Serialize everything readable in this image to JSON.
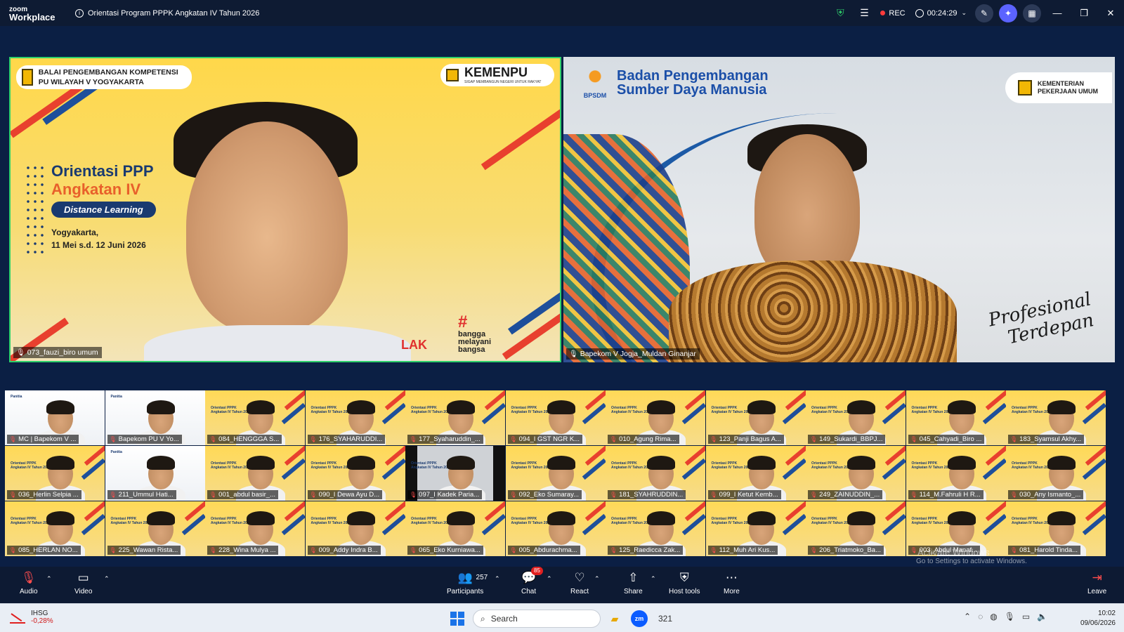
{
  "app": {
    "zoom": "zoom",
    "workplace": "Workplace"
  },
  "meeting_title": "Orientasi Program PPPK Angkatan IV Tahun 2026",
  "titlebar": {
    "rec": "REC",
    "timer": "00:24:29"
  },
  "speakers": [
    {
      "name": "073_fauzi_biro umum",
      "badge_left": "BALAI PENGEMBANGAN KOMPETENSI PU WILAYAH V YOGYAKARTA",
      "badge_right": "KEMENPU",
      "badge_right_sub": "SIGAP MEMBANGUN NEGERI UNTUK RAKYAT",
      "title_1": "Orientasi PPP",
      "title_2": "Angkatan IV",
      "pill": "Distance Learning",
      "location": "Yogyakarta,",
      "dates": "11 Mei s.d. 12 Juni 2026",
      "bangga": "#",
      "bangga_text": "bangga melayani bangsa",
      "lak": "LAK"
    },
    {
      "name": "Bapekom V Jogja_Muldan Ginanjar",
      "org_short": "BPSDM",
      "org_line1": "Badan Pengembangan",
      "org_line2": "Sumber Daya Manusia",
      "kementerian": "KEMENTERIAN PEKERJAAN UMUM",
      "motto_1": "Profesional",
      "motto_2": "Terdepan"
    }
  ],
  "participants": [
    {
      "name": "MC | Bapekom V ...",
      "style": "white"
    },
    {
      "name": "Bapekom PU V Yo...",
      "style": "white"
    },
    {
      "name": "084_HENGGGA S...",
      "style": "yellow"
    },
    {
      "name": "176_SYAHARUDDI...",
      "style": "yellow"
    },
    {
      "name": "177_Syaharuddin_...",
      "style": "yellow"
    },
    {
      "name": "094_I GST NGR K...",
      "style": "yellow"
    },
    {
      "name": "010_Agung Rima...",
      "style": "yellow"
    },
    {
      "name": "123_Panji Bagus A...",
      "style": "yellow"
    },
    {
      "name": "149_Sukardi_BBPJ...",
      "style": "yellow"
    },
    {
      "name": "045_Cahyadi_Biro ...",
      "style": "yellow"
    },
    {
      "name": "183_Syamsul Akhy...",
      "style": "yellow"
    },
    {
      "name": "036_Herlin Selpia ...",
      "style": "yellow"
    },
    {
      "name": "211_Ummul Hati...",
      "style": "white"
    },
    {
      "name": "001_abdul basir_...",
      "style": "yellow"
    },
    {
      "name": "090_I Dewa Ayu D...",
      "style": "yellow"
    },
    {
      "name": "097_I Kadek Paria...",
      "style": "dark"
    },
    {
      "name": "092_Eko Sumaray...",
      "style": "yellow"
    },
    {
      "name": "181_SYAHRUDDIN...",
      "style": "yellow"
    },
    {
      "name": "099_I Ketut Kemb...",
      "style": "yellow"
    },
    {
      "name": "249_ZAINUDDIN_...",
      "style": "yellow"
    },
    {
      "name": "114_M.Fahruli H R...",
      "style": "yellow"
    },
    {
      "name": "030_Any Ismanto_...",
      "style": "yellow"
    },
    {
      "name": "085_HERLAN NO...",
      "style": "yellow"
    },
    {
      "name": "225_Wawan Rista...",
      "style": "yellow"
    },
    {
      "name": "228_Wina Mulya ...",
      "style": "yellow"
    },
    {
      "name": "009_Addy Indra B...",
      "style": "yellow"
    },
    {
      "name": "065_Eko Kurniawa...",
      "style": "yellow"
    },
    {
      "name": "005_Abdurachma...",
      "style": "yellow"
    },
    {
      "name": "125_Raedicca Zak...",
      "style": "yellow"
    },
    {
      "name": "112_Muh Ari Kus...",
      "style": "yellow"
    },
    {
      "name": "206_Triatmoko_Ba...",
      "style": "yellow"
    },
    {
      "name": "003_Abdul Manaf...",
      "style": "yellow"
    },
    {
      "name": "081_Harold Tinda...",
      "style": "yellow"
    }
  ],
  "tile_mini": {
    "line1": "Orientasi PPPK",
    "line2": "Angkatan IV Tahun 2026",
    "panitia": "Panitia"
  },
  "watermark": {
    "line1": "Activate Windows",
    "line2": "Go to Settings to activate Windows."
  },
  "toolbar": {
    "audio": "Audio",
    "video": "Video",
    "participants": "Participants",
    "participants_count": "257",
    "chat": "Chat",
    "chat_badge": "85",
    "react": "React",
    "share": "Share",
    "host_tools": "Host tools",
    "more": "More",
    "leave": "Leave"
  },
  "taskbar": {
    "ihsg": "IHSG",
    "ihsg_change": "-0,28%",
    "search": "Search",
    "zoom_app": "zm",
    "calendar_app": "321",
    "time": "10:02",
    "date": "09/06/2026"
  },
  "colors": {
    "accent": "#2ed06b",
    "rec": "#ff3b3b",
    "brand_yellow": "#ffd84a",
    "stage_bg": "#0b1f44"
  }
}
